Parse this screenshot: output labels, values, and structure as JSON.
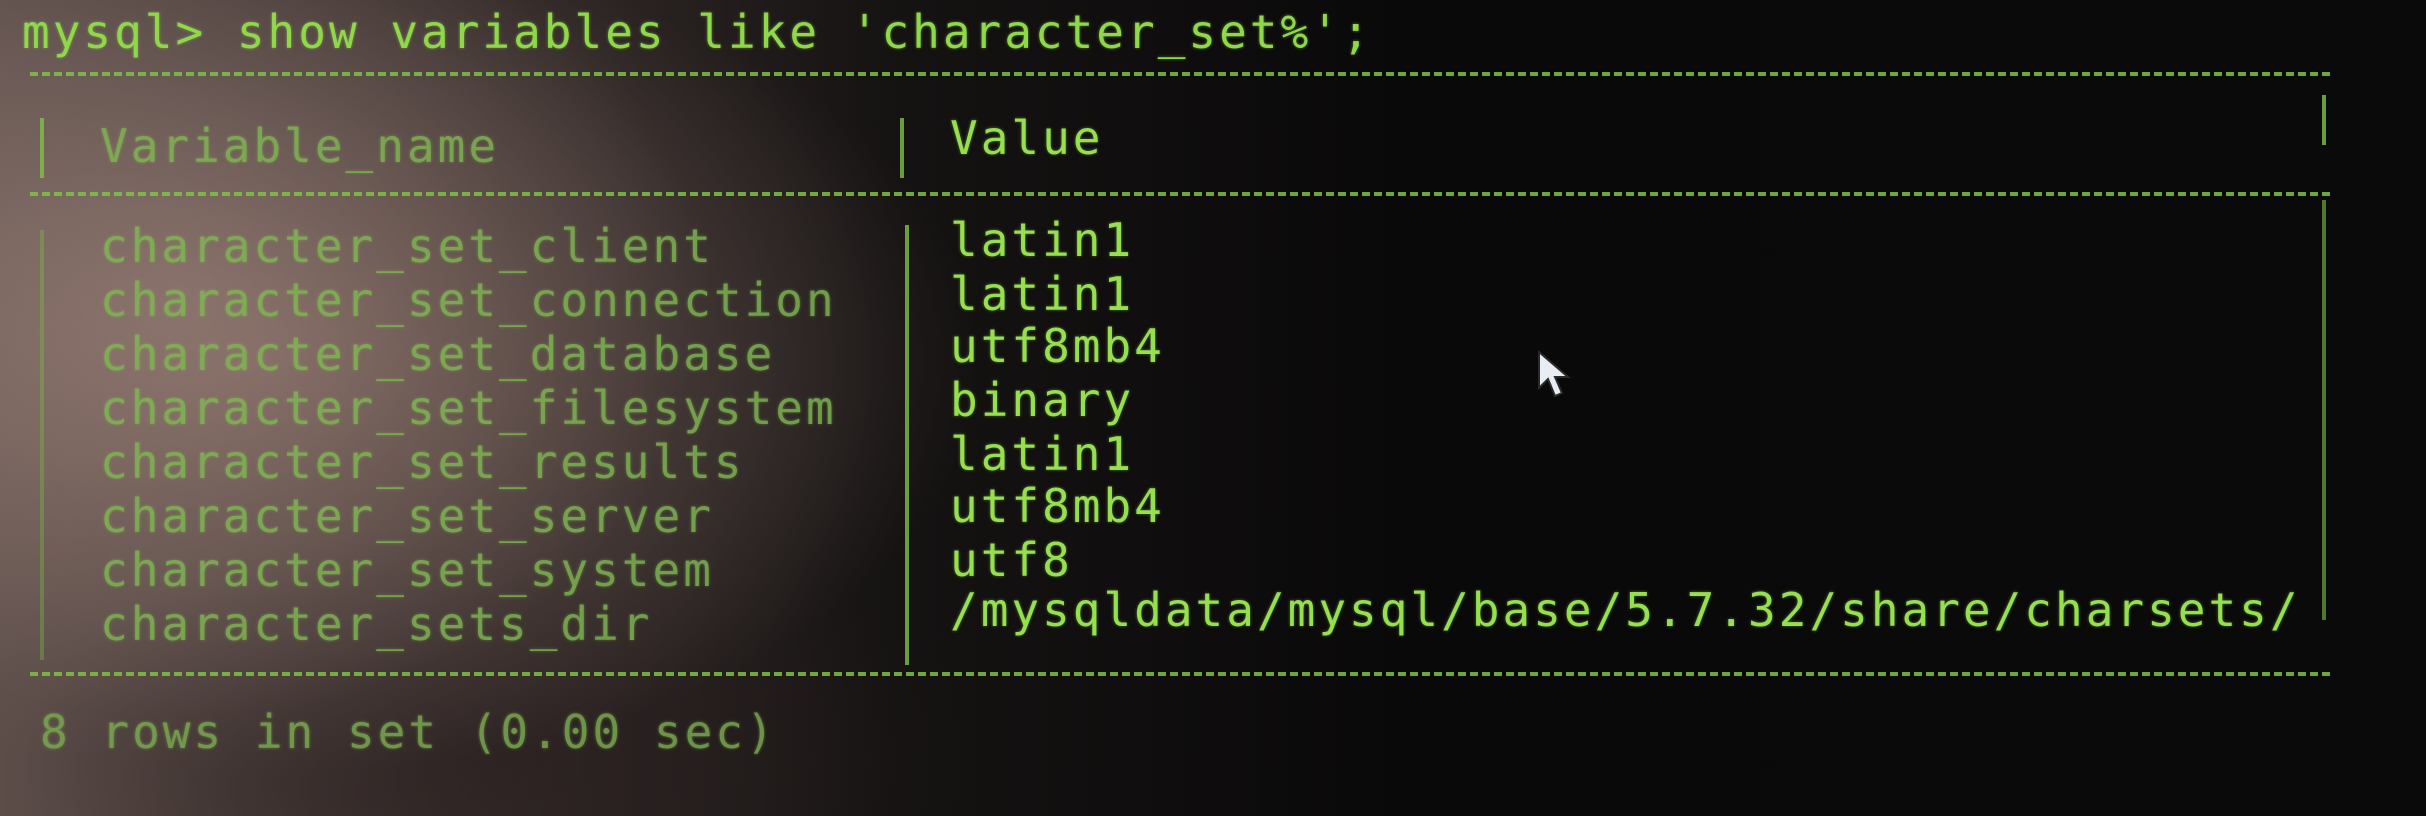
{
  "terminal": {
    "prompt": "mysql>",
    "command": " show variables like 'character_set%';",
    "footer": "8 rows in set (0.00 sec)"
  },
  "table": {
    "headers": [
      "Variable_name",
      "Value"
    ],
    "rows": [
      {
        "name": "character_set_client",
        "value": "latin1"
      },
      {
        "name": "character_set_connection",
        "value": "latin1"
      },
      {
        "name": "character_set_database",
        "value": "utf8mb4"
      },
      {
        "name": "character_set_filesystem",
        "value": "binary"
      },
      {
        "name": "character_set_results",
        "value": "latin1"
      },
      {
        "name": "character_set_server",
        "value": "utf8mb4"
      },
      {
        "name": "character_set_system",
        "value": "utf8"
      },
      {
        "name": "character_sets_dir",
        "value": "/mysqldata/mysql/base/5.7.32/share/charsets/"
      }
    ]
  },
  "colors": {
    "text": "#8fd84a",
    "background": "#0b0a0a"
  },
  "icons": {
    "pointer": "mouse-pointer-icon"
  }
}
